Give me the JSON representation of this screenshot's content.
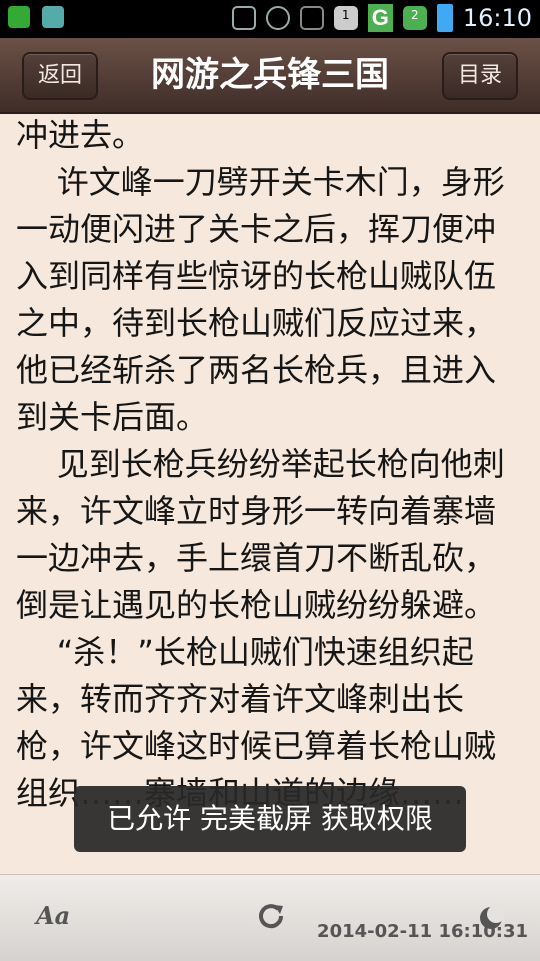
{
  "status_bar": {
    "time": "16:10",
    "network": "G",
    "signal_small": "1",
    "signal_small2": "2"
  },
  "header": {
    "back_label": "返回",
    "title": "网游之兵锋三国",
    "toc_label": "目录"
  },
  "content": {
    "paragraphs": [
      "冲进去。",
      "    许文峰一刀劈开关卡木门，身形一动便闪进了关卡之后，挥刀便冲入到同样有些惊讶的长枪山贼队伍之中，待到长枪山贼们反应过来，他已经斩杀了两名长枪兵，且进入到关卡后面。",
      "    见到长枪兵纷纷举起长枪向他刺来，许文峰立时身形一转向着寨墙一边冲去，手上缳首刀不断乱砍，倒是让遇见的长枪山贼纷纷躲避。",
      "    “杀！”长枪山贼们快速组织起来，转而齐齐对着许文峰刺出长枪，许文峰这时候已算着长枪山贼组织……寨墙和山道的边缘……"
    ]
  },
  "toast": {
    "text": "已允许 完美截屏 获取权限"
  },
  "bottom_bar": {
    "font_label": "Aa",
    "datetime": "2014-02-11 16:10:31"
  }
}
